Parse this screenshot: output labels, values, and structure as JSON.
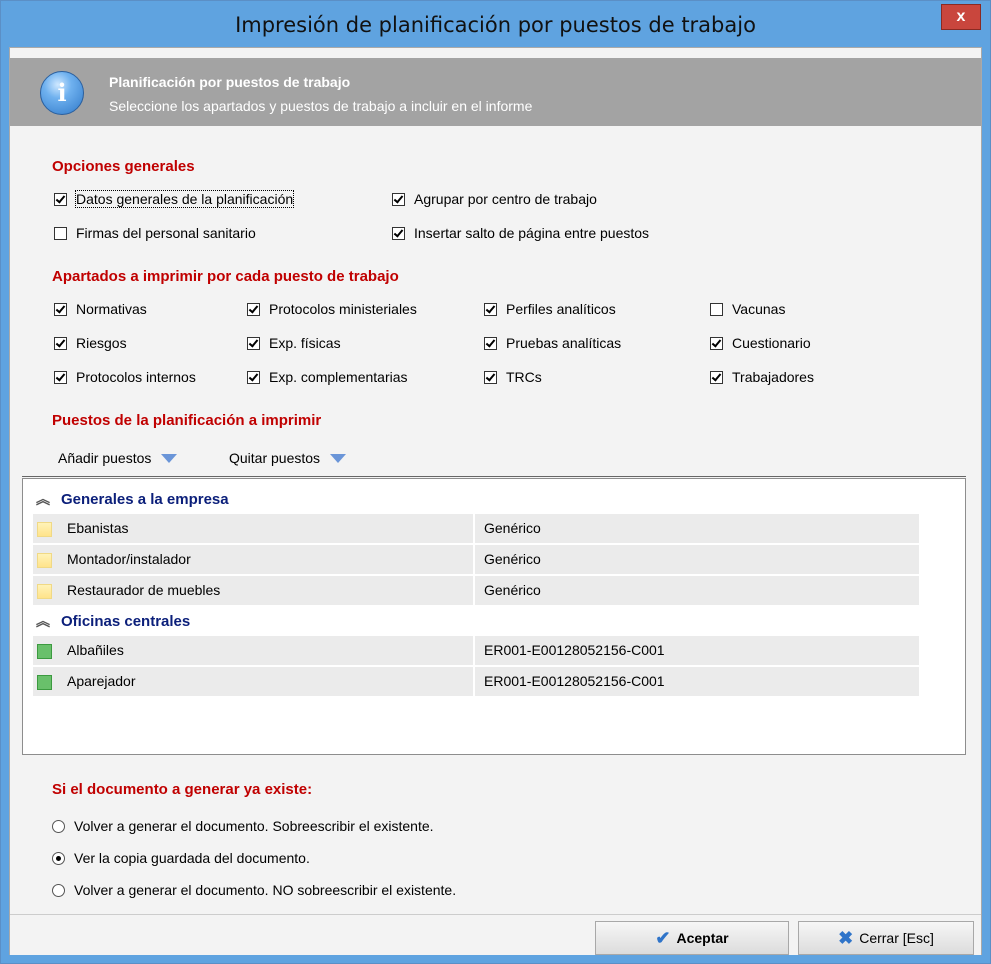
{
  "window": {
    "title": "Impresión de planificación por puestos de trabajo",
    "close_label": "x"
  },
  "banner": {
    "title": "Planificación por puestos de trabajo",
    "subtitle": "Seleccione los apartados y puestos de trabajo a incluir en el informe",
    "icon": "info-icon"
  },
  "general": {
    "heading": "Opciones generales",
    "options": [
      {
        "label": "Datos generales de la planificación",
        "checked": true
      },
      {
        "label": "Agrupar por centro de trabajo",
        "checked": true
      },
      {
        "label": "Firmas del personal sanitario",
        "checked": false
      },
      {
        "label": "Insertar salto de página entre puestos",
        "checked": true
      }
    ]
  },
  "sections": {
    "heading": "Apartados a imprimir por cada puesto de trabajo",
    "items": [
      {
        "label": "Normativas",
        "checked": true
      },
      {
        "label": "Protocolos ministeriales",
        "checked": true
      },
      {
        "label": "Perfiles analíticos",
        "checked": true
      },
      {
        "label": "Vacunas",
        "checked": false
      },
      {
        "label": "Riesgos",
        "checked": true
      },
      {
        "label": "Exp. físicas",
        "checked": true
      },
      {
        "label": "Pruebas analíticas",
        "checked": true
      },
      {
        "label": "Cuestionario",
        "checked": true
      },
      {
        "label": "Protocolos internos",
        "checked": true
      },
      {
        "label": "Exp. complementarias",
        "checked": true
      },
      {
        "label": "TRCs",
        "checked": true
      },
      {
        "label": "Trabajadores",
        "checked": true
      }
    ]
  },
  "positions": {
    "heading": "Puestos de la planificación a imprimir",
    "add_label": "Añadir puestos",
    "remove_label": "Quitar puestos",
    "groups": [
      {
        "label": "Generales a la empresa",
        "rows": [
          {
            "name": "Ebanistas",
            "code": "Genérico",
            "icon": "folder-icon"
          },
          {
            "name": "Montador/instalador",
            "code": "Genérico",
            "icon": "folder-icon"
          },
          {
            "name": "Restaurador de muebles",
            "code": "Genérico",
            "icon": "folder-icon"
          }
        ]
      },
      {
        "label": "Oficinas centrales",
        "rows": [
          {
            "name": "Albañiles",
            "code": "ER001-E00128052156-C001",
            "icon": "green-square-icon"
          },
          {
            "name": "Aparejador",
            "code": "ER001-E00128052156-C001",
            "icon": "green-square-icon"
          }
        ]
      }
    ]
  },
  "existing": {
    "heading": "Si el documento a generar ya existe:",
    "options": [
      {
        "label": "Volver a generar el documento. Sobreescribir el existente.",
        "selected": false
      },
      {
        "label": "Ver la copia guardada del documento.",
        "selected": true
      },
      {
        "label": "Volver a generar el documento. NO sobreescribir el existente.",
        "selected": false
      }
    ]
  },
  "buttons": {
    "accept_label": "Aceptar",
    "close_label": "Cerrar [Esc]"
  }
}
